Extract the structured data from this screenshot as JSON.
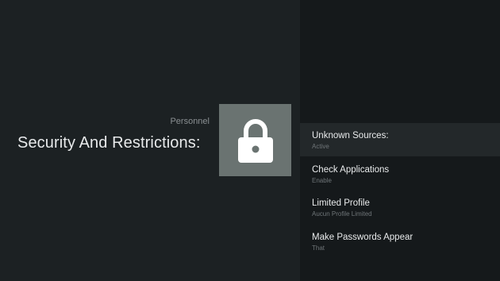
{
  "header": {
    "category": "Personnel",
    "title": "Security And Restrictions:"
  },
  "icon": {
    "name": "lock-icon",
    "color": "#ffffff",
    "tile_color": "#6a7371"
  },
  "settings": {
    "items": [
      {
        "title": "Unknown Sources:",
        "subtitle": "Active"
      },
      {
        "title": "Check Applications",
        "subtitle": "Enable"
      },
      {
        "title": "Limited Profile",
        "subtitle": "Aucun Profile Limited"
      },
      {
        "title": "Make Passwords Appear",
        "subtitle": "That"
      }
    ]
  }
}
